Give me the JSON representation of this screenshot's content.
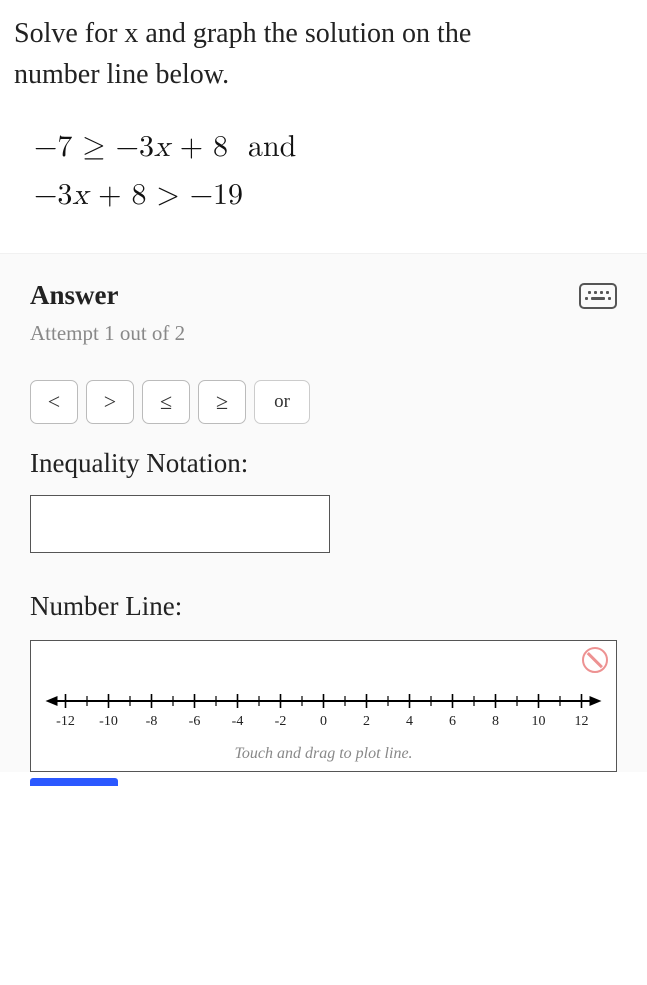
{
  "problem": {
    "line1": "Solve for x and graph the solution on the",
    "line2": "number line below.",
    "math1": "−7 ≥ −3x + 8  and",
    "math2": "−3x + 8 > −19"
  },
  "answer": {
    "title": "Answer",
    "attempt": "Attempt 1 out of 2",
    "ops": {
      "lt": "<",
      "gt": ">",
      "le": "≤",
      "ge": "≥",
      "or": "or"
    },
    "ineq_label": "Inequality Notation:",
    "numline_label": "Number Line:",
    "hint": "Touch and drag to plot line."
  },
  "numline": {
    "ticks": [
      "-12",
      "-10",
      "-8",
      "-6",
      "-4",
      "-2",
      "0",
      "2",
      "4",
      "6",
      "8",
      "10",
      "12"
    ]
  }
}
